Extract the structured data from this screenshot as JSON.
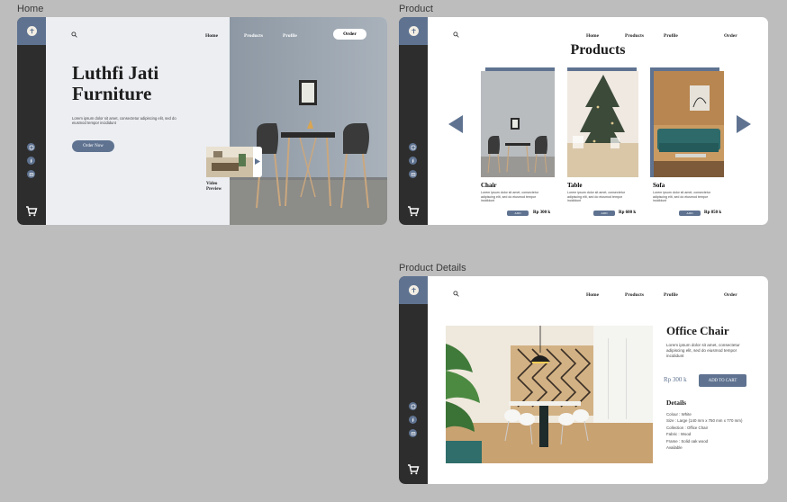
{
  "frames": {
    "home": "Home",
    "product": "Product",
    "details": "Product Details"
  },
  "colors": {
    "accent": "#5f7391",
    "sidebar": "#2d2d2d",
    "page_bg": "#bdbdbd",
    "hero_bg": "#eceef2"
  },
  "nav": {
    "home": "Home",
    "products": "Products",
    "profile": "Profile",
    "order": "Order"
  },
  "icons": [
    "search-icon",
    "instagram-icon",
    "facebook-icon",
    "mail-icon",
    "cart-icon",
    "logo-icon",
    "play-icon",
    "arrow-left-icon",
    "arrow-right-icon"
  ],
  "home": {
    "title_line1": "Luthfi Jati",
    "title_line2": "Furniture",
    "lorem": "Lorem ipsum dolor sit amet, consectetur adipiscing elit, sed do eiusmod tempor incididunt",
    "order_now": "Order Now",
    "video_line1": "Video",
    "video_line2": "Preview"
  },
  "product": {
    "heading": "Products",
    "items": [
      {
        "name": "Chair",
        "desc": "Lorem ipsum dolor sit amet, consectetur adipiscing elit, sed do eiusmod tempor incididunt",
        "button": "ADD",
        "price": "Rp 300 k"
      },
      {
        "name": "Table",
        "desc": "Lorem ipsum dolor sit amet, consectetur adipiscing elit, sed do eiusmod tempor incididunt",
        "button": "ADD",
        "price": "Rp 600 k"
      },
      {
        "name": "Sofa",
        "desc": "Lorem ipsum dolor sit amet, consectetur adipiscing elit, sed do eiusmod tempor incididunt",
        "button": "ADD",
        "price": "Rp 850 k"
      }
    ]
  },
  "details": {
    "title": "Office Chair",
    "desc": "Lorem ipsum dolor sit amet, consectetur adipiscing elit, sed do eiusmod tempor incididunt",
    "price": "Rp 300 k",
    "add_to_cart": "ADD TO CART",
    "details_heading": "Details",
    "specs": [
      "Colour : White",
      "Size : Large (140 mm x 750 mm x 770 mm)",
      "Collection : Office Chair",
      "Fabric : Wood",
      "Frame : Solid oak wood",
      "Available"
    ]
  }
}
